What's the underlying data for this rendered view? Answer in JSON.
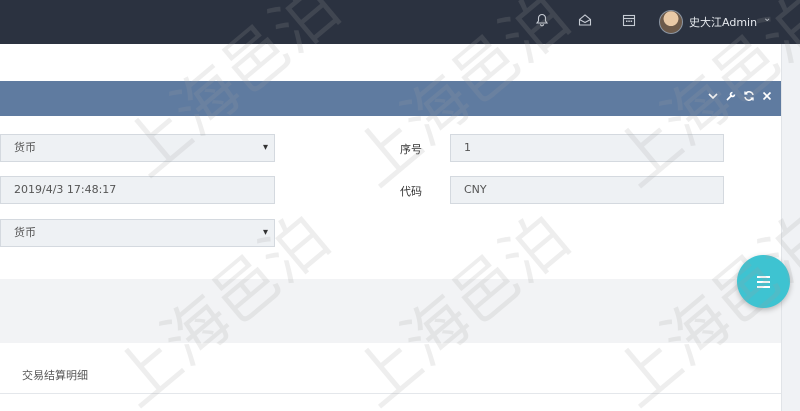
{
  "topbar": {
    "icons": [
      "bell-icon",
      "inbox-icon",
      "calendar-icon"
    ],
    "username": "史大江Admin"
  },
  "panel": {
    "tools": [
      "chevron-down-icon",
      "wrench-icon",
      "refresh-icon",
      "close-icon"
    ]
  },
  "form": {
    "currency_select_1": "货币",
    "datetime_value": "2019/4/3 17:48:17",
    "currency_select_2": "货币",
    "seq_label": "序号",
    "seq_value": "1",
    "code_label": "代码",
    "code_value": "CNY"
  },
  "section": {
    "title": "交易结算明细"
  },
  "watermark": "上海邑泊",
  "colors": {
    "topbar": "#2b3240",
    "panel_header": "#5f7ba0",
    "fab": "#3ec3d1"
  }
}
